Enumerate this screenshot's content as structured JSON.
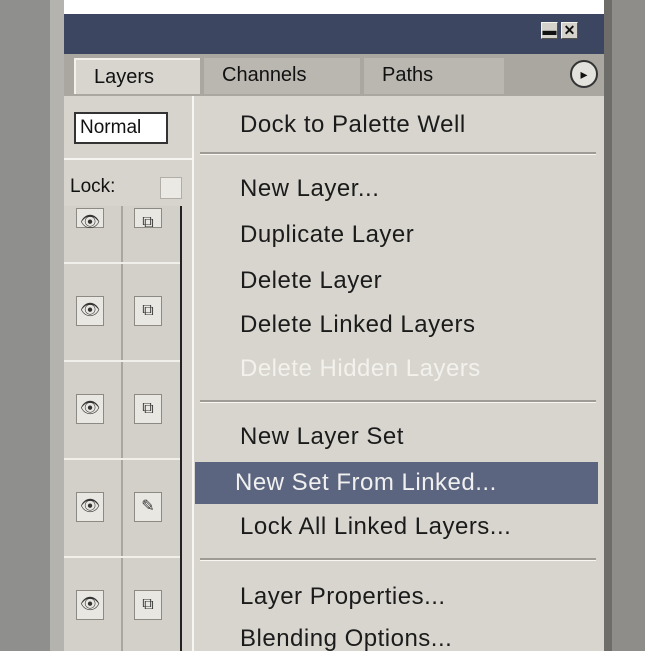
{
  "palette": {
    "tabs": [
      {
        "label": "Layers",
        "active": true
      },
      {
        "label": "Channels",
        "active": false
      },
      {
        "label": "Paths",
        "active": false
      }
    ],
    "title_buttons": {
      "minimize": "▬",
      "close": "✕"
    },
    "menu_button_glyph": "▸"
  },
  "layers_panel": {
    "blend_mode": "Normal",
    "lock_label": "Lock:",
    "rows": [
      {
        "visible_icon": "eye-icon",
        "link_icon": "chain-link-icon"
      },
      {
        "visible_icon": "eye-icon",
        "link_icon": "chain-link-icon"
      },
      {
        "visible_icon": "eye-icon",
        "link_icon": "chain-link-icon"
      },
      {
        "visible_icon": "eye-icon",
        "link_icon": "brush-icon"
      },
      {
        "visible_icon": "eye-icon",
        "link_icon": "chain-link-icon"
      }
    ]
  },
  "flyout_menu": {
    "items": [
      {
        "label": "Dock to Palette Well",
        "disabled": false,
        "highlighted": false
      },
      {
        "label": "New Layer...",
        "disabled": false,
        "highlighted": false
      },
      {
        "label": "Duplicate Layer",
        "disabled": false,
        "highlighted": false
      },
      {
        "label": "Delete Layer",
        "disabled": false,
        "highlighted": false
      },
      {
        "label": "Delete Linked Layers",
        "disabled": false,
        "highlighted": false
      },
      {
        "label": "Delete Hidden Layers",
        "disabled": true,
        "highlighted": false
      },
      {
        "label": "New Layer Set",
        "disabled": false,
        "highlighted": false
      },
      {
        "label": "New Set From Linked...",
        "disabled": false,
        "highlighted": true
      },
      {
        "label": "Lock All Linked Layers...",
        "disabled": false,
        "highlighted": false
      },
      {
        "label": "Layer Properties...",
        "disabled": false,
        "highlighted": false
      },
      {
        "label": "Blending Options...",
        "disabled": false,
        "highlighted": false
      }
    ]
  },
  "colors": {
    "title_bar": "#3d4661",
    "panel_bg": "#d6d4cd",
    "highlight": "#5c657f"
  }
}
